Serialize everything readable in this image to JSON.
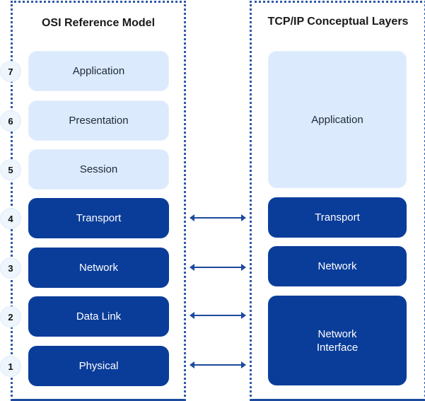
{
  "osi": {
    "title": "OSI Reference Model",
    "layers": [
      {
        "number": "7",
        "label": "Application",
        "style": "light"
      },
      {
        "number": "6",
        "label": "Presentation",
        "style": "light"
      },
      {
        "number": "5",
        "label": "Session",
        "style": "light"
      },
      {
        "number": "4",
        "label": "Transport",
        "style": "dark"
      },
      {
        "number": "3",
        "label": "Network",
        "style": "dark"
      },
      {
        "number": "2",
        "label": "Data Link",
        "style": "dark"
      },
      {
        "number": "1",
        "label": "Physical",
        "style": "dark"
      }
    ]
  },
  "tcpip": {
    "title": "TCP/IP Conceptual Layers",
    "layers": [
      {
        "label": "Application",
        "style": "light"
      },
      {
        "label": "Transport",
        "style": "dark"
      },
      {
        "label": "Network",
        "style": "dark"
      },
      {
        "label": "Network Interface",
        "line1": "Network",
        "line2": "Interface",
        "style": "dark"
      }
    ]
  },
  "colors": {
    "light_layer": "#dbeafc",
    "dark_layer": "#0a3d9a",
    "border": "#2f5aa8"
  }
}
